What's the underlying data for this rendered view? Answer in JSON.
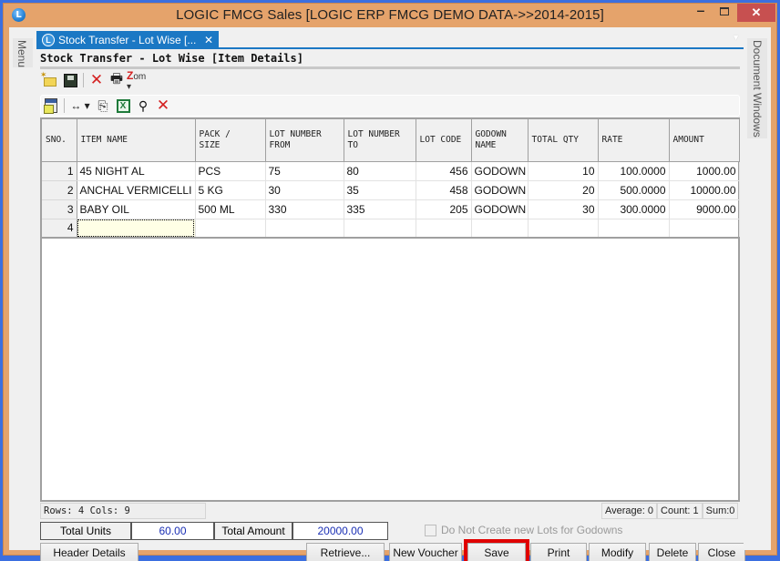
{
  "window": {
    "title": "LOGIC FMCG Sales  [LOGIC ERP FMCG DEMO DATA->>2014-2015]",
    "app_icon": "logic-app-icon",
    "controls": {
      "minimize": "–",
      "maximize": "□",
      "close": "✕"
    }
  },
  "side_panels": {
    "left": "Menu",
    "right": "Document Windows"
  },
  "doc_tab": {
    "label": "Stock Transfer - Lot Wise [...",
    "close": "✕"
  },
  "form": {
    "title": "Stock Transfer - Lot Wise [Item Details]"
  },
  "toolbar1": {
    "icons": [
      "new-icon",
      "save-icon",
      "delete-icon",
      "print-icon",
      "zoom-icon"
    ],
    "zoom_label": "om"
  },
  "toolbar2": {
    "icons": [
      "form-icon",
      "column-width-icon",
      "copy-icon",
      "excel-icon",
      "find-icon",
      "remove-icon"
    ]
  },
  "grid": {
    "columns": [
      {
        "l1": "SNO.",
        "l2": ""
      },
      {
        "l1": "ITEM NAME",
        "l2": ""
      },
      {
        "l1": "PACK /",
        "l2": "SIZE"
      },
      {
        "l1": "LOT NUMBER",
        "l2": "FROM"
      },
      {
        "l1": "LOT NUMBER",
        "l2": "TO"
      },
      {
        "l1": "LOT CODE",
        "l2": ""
      },
      {
        "l1": "GODOWN",
        "l2": "NAME"
      },
      {
        "l1": "TOTAL QTY",
        "l2": ""
      },
      {
        "l1": "RATE",
        "l2": ""
      },
      {
        "l1": "AMOUNT",
        "l2": ""
      }
    ],
    "rows": [
      {
        "sno": "1",
        "item": "45 NIGHT AL",
        "pack": "PCS",
        "lot_from": "75",
        "lot_to": "80",
        "lot_code": "456",
        "godown": "GODOWN",
        "qty": "10",
        "rate": "100.0000",
        "amount": "1000.00"
      },
      {
        "sno": "2",
        "item": "ANCHAL VERMICELLI",
        "pack": "5 KG",
        "lot_from": "30",
        "lot_to": "35",
        "lot_code": "458",
        "godown": "GODOWN",
        "qty": "20",
        "rate": "500.0000",
        "amount": "10000.00"
      },
      {
        "sno": "3",
        "item": "BABY OIL",
        "pack": "500 ML",
        "lot_from": "330",
        "lot_to": "335",
        "lot_code": "205",
        "godown": "GODOWN",
        "qty": "30",
        "rate": "300.0000",
        "amount": "9000.00"
      },
      {
        "sno": "4",
        "item": "",
        "pack": "",
        "lot_from": "",
        "lot_to": "",
        "lot_code": "",
        "godown": "",
        "qty": "",
        "rate": "",
        "amount": ""
      }
    ]
  },
  "status": {
    "rows_cols": "Rows: 4  Cols: 9",
    "average": "Average: 0",
    "count": "Count: 1",
    "sum": "Sum:0"
  },
  "totals": {
    "units_label": "Total Units",
    "units_value": "60.00",
    "amount_label": "Total Amount",
    "amount_value": "20000.00"
  },
  "checkbox": {
    "label": "Do Not Create new Lots for Godowns",
    "checked": false,
    "enabled": false
  },
  "buttons": {
    "header_details": "Header Details",
    "retrieve": "Retrieve...",
    "new_voucher": "New Voucher",
    "save": "Save",
    "print": "Print",
    "modify": "Modify",
    "delete": "Delete",
    "close": "Close"
  },
  "highlight": {
    "target": "save",
    "color": "#e00000"
  }
}
